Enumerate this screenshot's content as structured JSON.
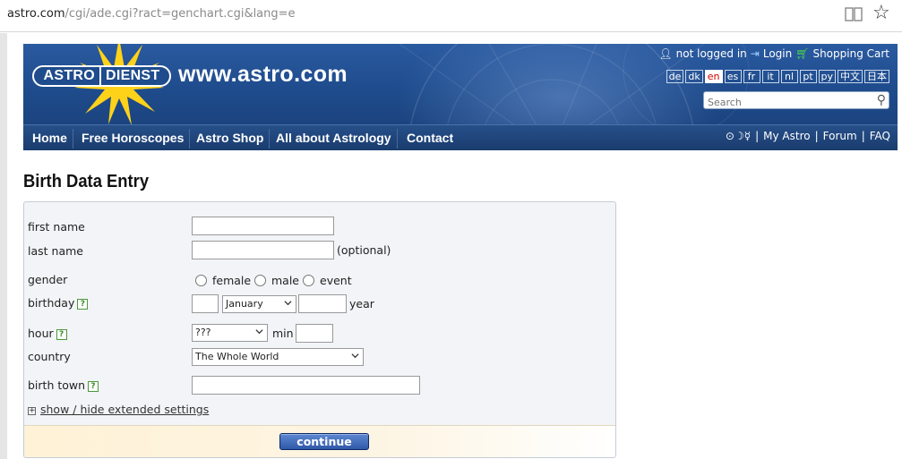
{
  "browser": {
    "url_host": "astro.com",
    "url_rest": "/cgi/ade.cgi?ract=genchart.cgi&lang=e",
    "reader_icon": "book-icon",
    "bookmark_icon": "star-icon"
  },
  "header": {
    "logo_left": "ASTRO",
    "logo_right": "DIENST",
    "site_name": "www.astro.com",
    "user_status": "not logged in",
    "login": "Login",
    "cart": "Shopping Cart",
    "languages": [
      "de",
      "dk",
      "en",
      "es",
      "fr",
      "it",
      "nl",
      "pt",
      "ру",
      "中文",
      "日本"
    ],
    "active_language": "en",
    "search_placeholder": "Search"
  },
  "nav": {
    "items": [
      "Home",
      "Free Horoscopes",
      "Astro Shop",
      "All about Astrology",
      "Contact"
    ],
    "glyphs": "⊙☽☿",
    "right_links": [
      "My Astro",
      "Forum",
      "FAQ"
    ]
  },
  "page": {
    "title": "Birth Data Entry"
  },
  "form": {
    "first_name_label": "first name",
    "first_name_value": "",
    "last_name_label": "last name",
    "last_name_value": "",
    "optional_hint": "(optional)",
    "gender_label": "gender",
    "gender_options": [
      "female",
      "male",
      "event"
    ],
    "birthday_label": "birthday",
    "day_value": "",
    "month_value": "January",
    "year_value": "",
    "year_hint": "year",
    "hour_label": "hour",
    "hour_value": "???",
    "min_label": "min",
    "min_value": "",
    "country_label": "country",
    "country_value": "The Whole World",
    "birth_town_label": "birth town",
    "birth_town_value": "",
    "help_glyph": "?",
    "extended_settings": "show / hide extended settings",
    "continue_label": "continue"
  },
  "colors": {
    "banner": "#1f4c8d",
    "nav": "#1f4478",
    "help_green": "#3c8a2c",
    "continue_button": "#3a63b0"
  }
}
